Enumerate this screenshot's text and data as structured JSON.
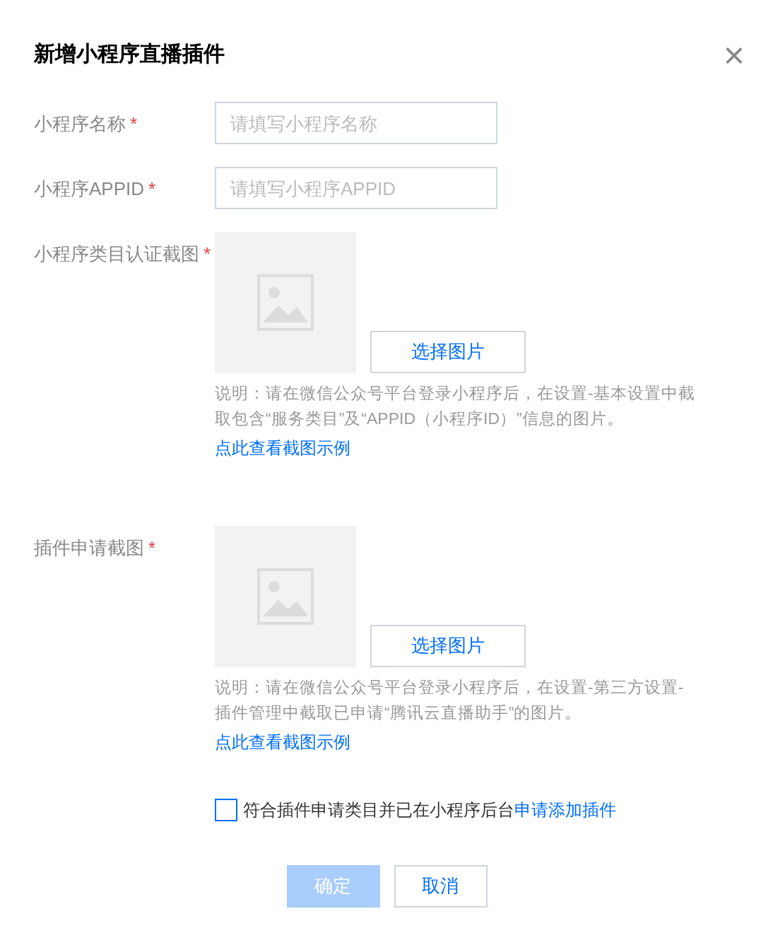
{
  "dialog": {
    "title": "新增小程序直播插件",
    "close": "×"
  },
  "fields": [
    {
      "kind": "text",
      "label": "小程序名称",
      "mark": "*",
      "placeholder": "请填写小程序名称"
    },
    {
      "kind": "text",
      "label": "小程序APPID",
      "mark": "*",
      "placeholder": "请填写小程序APPID"
    },
    {
      "kind": "upload",
      "label": "小程序类目认证截图",
      "mark": "*",
      "button": "选择图片",
      "note": "说明：请在微信公众号平台登录小程序后，在设置-基本设置中截取包含“服务类目”及“APPID（小程序ID）”信息的图片。",
      "link": "点此查看截图示例"
    },
    {
      "kind": "upload",
      "label": "插件申请截图",
      "mark": "*",
      "button": "选择图片",
      "note": "说明：请在微信公众号平台登录小程序后，在设置-第三方设置-插件管理中截取已申请“腾讯云直播助手”的图片。",
      "link": "点此查看截图示例"
    }
  ],
  "agreement": {
    "checked": false,
    "text": "符合插件申请类目并已在小程序后台",
    "link": "申请添加插件"
  },
  "buttons": [
    {
      "kind": "primary",
      "label": "确定",
      "disabled": true
    },
    {
      "kind": "secondary",
      "label": "取消",
      "disabled": false
    }
  ]
}
